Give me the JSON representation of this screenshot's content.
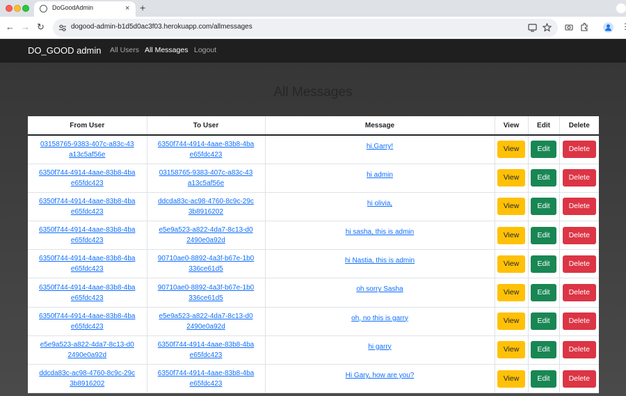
{
  "browser": {
    "tab_title": "DoGoodAdmin",
    "tab_close": "×",
    "new_tab": "+",
    "url": "dogood-admin-b1d5d0ac3f03.herokuapp.com/allmessages",
    "back": "←",
    "forward": "→",
    "reload": "↻"
  },
  "navbar": {
    "brand": "DO_GOOD admin",
    "links": [
      "All Users",
      "All Messages",
      "Logout"
    ],
    "active": "All Messages"
  },
  "page_title": "All Messages",
  "table": {
    "headers": [
      "From User",
      "To User",
      "Message",
      "View",
      "Edit",
      "Delete"
    ],
    "buttons": {
      "view": "View",
      "edit": "Edit",
      "delete": "Delete"
    },
    "rows": [
      {
        "from": "03158765-9383-407c-a83c-43a13c5af56e",
        "to": "6350f744-4914-4aae-83b8-4bae65fdc423",
        "message": "hi,Garry!"
      },
      {
        "from": "6350f744-4914-4aae-83b8-4bae65fdc423",
        "to": "03158765-9383-407c-a83c-43a13c5af56e",
        "message": "hi admin"
      },
      {
        "from": "6350f744-4914-4aae-83b8-4bae65fdc423",
        "to": "ddcda83c-ac98-4760-8c9c-29c3b8916202",
        "message": "hi olivia,"
      },
      {
        "from": "6350f744-4914-4aae-83b8-4bae65fdc423",
        "to": "e5e9a523-a822-4da7-8c13-d02490e0a92d",
        "message": "hi sasha, this is admin"
      },
      {
        "from": "6350f744-4914-4aae-83b8-4bae65fdc423",
        "to": "90710ae0-8892-4a3f-b67e-1b0336ce61d5",
        "message": "hi Nastia, this is admin"
      },
      {
        "from": "6350f744-4914-4aae-83b8-4bae65fdc423",
        "to": "90710ae0-8892-4a3f-b67e-1b0336ce61d5",
        "message": "oh sorry Sasha"
      },
      {
        "from": "6350f744-4914-4aae-83b8-4bae65fdc423",
        "to": "e5e9a523-a822-4da7-8c13-d02490e0a92d",
        "message": "oh, no this is garry"
      },
      {
        "from": "e5e9a523-a822-4da7-8c13-d02490e0a92d",
        "to": "6350f744-4914-4aae-83b8-4bae65fdc423",
        "message": "hi garry"
      },
      {
        "from": "ddcda83c-ac98-4760-8c9c-29c3b8916202",
        "to": "6350f744-4914-4aae-83b8-4bae65fdc423",
        "message": "Hi Gary, how are you?"
      }
    ]
  }
}
